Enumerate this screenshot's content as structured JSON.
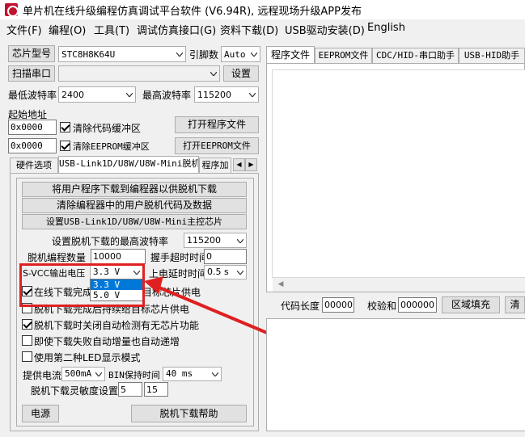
{
  "window": {
    "title": "单片机在线升级编程仿真调试平台软件 (V6.94R), 远程现场升级APP发布"
  },
  "menu": [
    "文件(F)",
    "编程(O)",
    "工具(T)",
    "调试仿真接口(G)",
    "资料下载(D)",
    "USB驱动安装(D)",
    "English"
  ],
  "chip": {
    "label": "芯片型号",
    "value": "STC8H8K64U",
    "pins_label": "引脚数",
    "pins_value": "Auto"
  },
  "port": {
    "scan_label": "扫描串口",
    "value": "",
    "settings_label": "设置"
  },
  "baud": {
    "min_label": "最低波特率",
    "min_value": "2400",
    "max_label": "最高波特率",
    "max_value": "115200"
  },
  "start_addr": {
    "label": "起始地址",
    "code_addr": "0x0000",
    "clear_code": "清除代码缓冲区",
    "open_program": "打开程序文件",
    "eeprom_addr": "0x0000",
    "clear_eeprom": "清除EEPROM缓冲区",
    "open_eeprom": "打开EEPROM文件"
  },
  "left_tabs": [
    "硬件选项",
    "USB-Link1D/U8W/U8W-Mini脱机",
    "程序加"
  ],
  "offline": {
    "btn_download": "将用户程序下载到编程器以供脱机下载",
    "btn_clear": "清除编程器中的用户脱机代码及数据",
    "btn_set_chip": "设置USB-Link1D/U8W/U8W-Mini主控芯片",
    "max_baud_label": "设置脱机下载的最高波特率",
    "max_baud_value": "115200",
    "count_label": "脱机编程数量",
    "count_value": "10000",
    "timeout_label": "握手超时时间",
    "timeout_value": "0",
    "vcc_label": "S-VCC输出电压",
    "vcc_value": "3.3 V",
    "vcc_options": [
      "3.3 V",
      "5.0 V"
    ],
    "delay_label": "上电延时时间",
    "delay_value": "0.5 s",
    "opt1": "在线下载完成",
    "opt1_rest": "目标芯片供电",
    "opt2": "脱机下载完成后持续给目标芯片供电",
    "opt3": "脱机下载时关闭自动检测有无芯片功能",
    "opt4": "即使下载失败自动增量也自动递增",
    "opt5": "使用第二种LED显示模式",
    "current_label": "提供电流",
    "current_value": "500mA",
    "bin_label": "BIN保持时间",
    "bin_value": "40 ms",
    "sens_label": "脱机下载灵敏度设置",
    "sens_a": "5",
    "sens_b": "15",
    "power_btn": "电源",
    "help_btn": "脱机下载帮助"
  },
  "right_tabs": [
    "程序文件",
    "EEPROM文件",
    "CDC/HID-串口助手",
    "USB-HID助手"
  ],
  "code_bar": {
    "len_label": "代码长度",
    "len_value": "00000",
    "checksum_label": "校验和",
    "checksum_value": "000000",
    "fill_btn": "区域填充",
    "clear_btn": "清"
  },
  "colors": {
    "highlight_red": "#e02020",
    "selection_blue": "#0078d7",
    "title_bg": "#ffffff",
    "panel_bg": "#f0f0f0"
  }
}
